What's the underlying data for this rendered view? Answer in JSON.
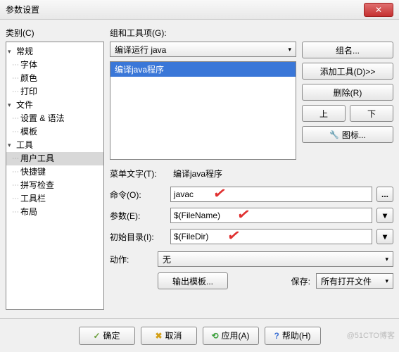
{
  "window": {
    "title": "参数设置"
  },
  "left": {
    "label": "类别(C)",
    "tree": [
      {
        "label": "常规",
        "parent": true,
        "children": [
          "字体",
          "颜色",
          "打印"
        ]
      },
      {
        "label": "文件",
        "parent": true,
        "children": [
          "设置 & 语法",
          "模板"
        ]
      },
      {
        "label": "工具",
        "parent": true,
        "children": [
          "用户工具",
          "快捷键",
          "拼写检查",
          "工具栏",
          "布局"
        ]
      }
    ],
    "selected": "用户工具"
  },
  "right": {
    "group_label": "组和工具项(G):",
    "group_combo": "编译运行 java",
    "list_item": "编译java程序",
    "buttons": {
      "group": "组名...",
      "add": "添加工具(D)>>",
      "delete": "删除(R)",
      "up": "上",
      "down": "下",
      "icon": "图标..."
    },
    "fields": {
      "menu_text_label": "菜单文字(T):",
      "menu_text": "编译java程序",
      "command_label": "命令(O):",
      "command": "javac",
      "args_label": "参数(E):",
      "args": "$(FileName)",
      "initdir_label": "初始目录(I):",
      "initdir": "$(FileDir)"
    },
    "action_label": "动作:",
    "action_value": "无",
    "output_btn": "输出模板...",
    "save_label": "保存:",
    "save_value": "所有打开文件"
  },
  "buttons": {
    "ok": "确定",
    "cancel": "取消",
    "apply": "应用(A)",
    "help": "帮助(H)"
  },
  "watermark": "@51CTO博客"
}
